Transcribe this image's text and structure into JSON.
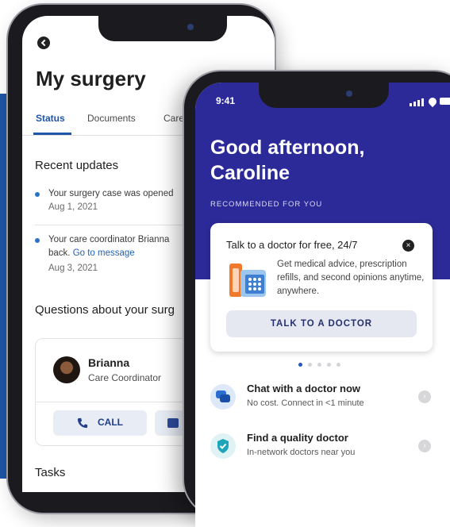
{
  "left_screen": {
    "title": "My surgery",
    "tabs": [
      "Status",
      "Documents",
      "Care t"
    ],
    "recent_updates_heading": "Recent updates",
    "updates": [
      {
        "line1": "Your surgery case was opened",
        "line2": "",
        "link": "",
        "date": "Aug 1, 2021"
      },
      {
        "line1": "Your care coordinator Brianna",
        "line2": "back.",
        "link": "Go to message",
        "date": "Aug 3, 2021"
      }
    ],
    "questions_heading": "Questions about your surg",
    "coordinator": {
      "name": "Brianna",
      "role": "Care Coordinator"
    },
    "call_label": "CALL",
    "message_label_partial": "M",
    "tasks_heading": "Tasks"
  },
  "right_screen": {
    "time": "9:41",
    "greeting": "Good afternoon, Caroline",
    "recommended_label": "RECOMMENDED FOR YOU",
    "promo": {
      "title": "Talk to a doctor for free, 24/7",
      "description": "Get medical advice, prescription refills, and second opinions anytime, anywhere.",
      "button": "TALK TO A DOCTOR",
      "close_icon": "×"
    },
    "carousel": {
      "count": 5,
      "active": 1
    },
    "items": [
      {
        "title": "Chat with a doctor now",
        "subtitle": "No cost. Connect in <1 minute",
        "icon": "chat-bubbles-icon"
      },
      {
        "title": "Find a quality doctor",
        "subtitle": "In-network doctors near you",
        "icon": "shield-check-icon"
      }
    ]
  },
  "colors": {
    "brand_blue": "#2b2a98",
    "link_blue": "#2263b6",
    "accent_blue": "#2056a8"
  }
}
